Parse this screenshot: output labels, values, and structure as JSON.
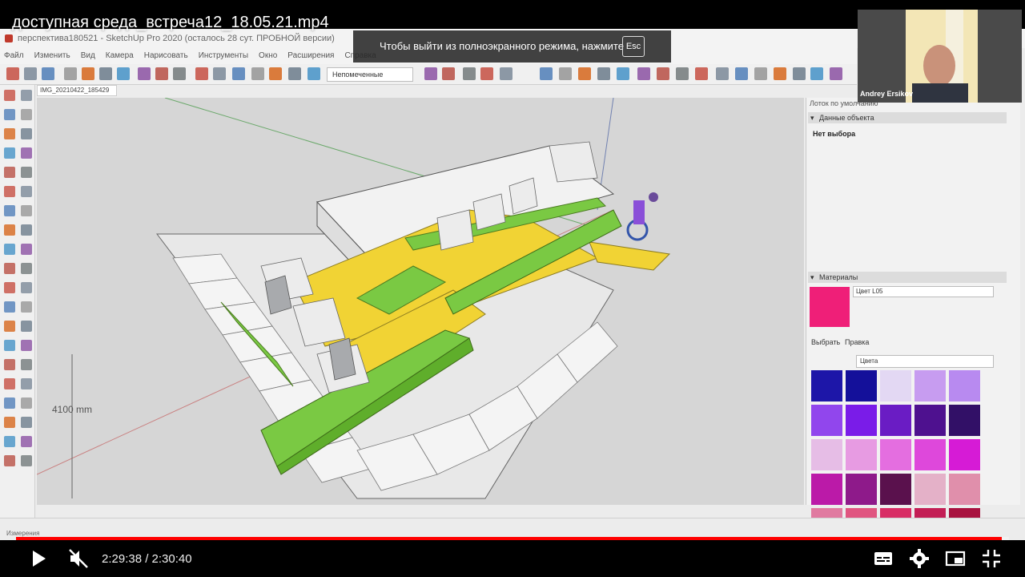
{
  "video": {
    "title": "доступная среда_встреча12_18.05.21.mp4",
    "fullscreen_notice": "Чтобы выйти из полноэкранного режима, нажмите",
    "esc_key": "Esc",
    "presenter_name": "Andrey Ersikov",
    "current_time": "2:29:38",
    "duration": "2:30:40",
    "time_display": "2:29:38 / 2:30:40",
    "progress": 0.9928,
    "accent_color": "#ff0000"
  },
  "sketchup": {
    "window_title": "перспектива180521 - SketchUp Pro 2020 (осталось 28 сут. ПРОБНОЙ версии)",
    "menu": [
      "Файл",
      "Изменить",
      "Вид",
      "Камера",
      "Нарисовать",
      "Инструменты",
      "Окно",
      "Расширения",
      "Справка"
    ],
    "layer_select": "Непомеченные",
    "scene_tab": "IMG_20210422_185429",
    "dimension_label": "4100 mm",
    "status_text": "Измерения",
    "tray": {
      "title": "Лоток по умолчанию",
      "entity_info_header": "Данные объекта",
      "no_selection": "Нет выбора",
      "materials_header": "Материалы",
      "material_name": "Цвет L05",
      "material_color": "#ef1f78",
      "tab_select": "Выбрать",
      "tab_edit": "Правка",
      "material_category": "Цвета",
      "palette": [
        "#1d16a8",
        "#14109a",
        "#e3d8f3",
        "#c79cf0",
        "#b88af0",
        "#9146ed",
        "#7a1ce8",
        "#6a1cc4",
        "#4e118f",
        "#321067",
        "#e6bde6",
        "#e79be2",
        "#e46ee0",
        "#de48db",
        "#d61bd6",
        "#bb1aa8",
        "#8e1a8a",
        "#5a114d",
        "#e4b1c8",
        "#e08fab",
        "#e07aa0",
        "#e05580",
        "#d82d65",
        "#c31e55",
        "#a8123f"
      ]
    }
  }
}
